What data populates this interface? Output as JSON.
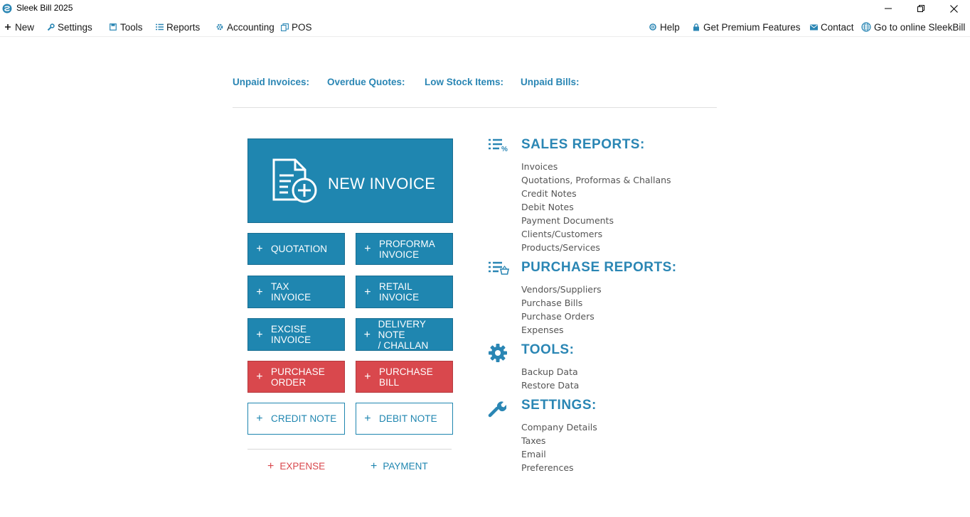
{
  "window": {
    "title": "Sleek Bill 2025"
  },
  "menu": {
    "left": [
      {
        "label": "New",
        "icon": "plus-icon"
      },
      {
        "label": "Settings",
        "icon": "wrench-icon"
      },
      {
        "label": "Tools",
        "icon": "floppy-icon"
      },
      {
        "label": "Reports",
        "icon": "list-icon"
      },
      {
        "label": "Accounting",
        "icon": "gear-icon"
      },
      {
        "label": "POS",
        "icon": "copy-icon"
      }
    ],
    "right": [
      {
        "label": "Help",
        "icon": "lifebuoy-icon"
      },
      {
        "label": "Get Premium Features",
        "icon": "lock-icon"
      },
      {
        "label": "Contact",
        "icon": "envelope-icon"
      },
      {
        "label": "Go to online SleekBill",
        "icon": "globe-icon"
      }
    ]
  },
  "status": {
    "unpaid_invoices": "Unpaid Invoices:",
    "overdue_quotes": "Overdue Quotes:",
    "low_stock": "Low Stock Items:",
    "unpaid_bills": "Unpaid Bills:"
  },
  "actions": {
    "new_invoice": "NEW INVOICE",
    "quotation": "QUOTATION",
    "proforma_1": "PROFORMA",
    "proforma_2": "INVOICE",
    "tax_1": "TAX",
    "tax_2": "INVOICE",
    "retail_1": "RETAIL",
    "retail_2": "INVOICE",
    "excise_1": "EXCISE",
    "excise_2": "INVOICE",
    "delivery_1": "DELIVERY NOTE",
    "delivery_2": "/ CHALLAN",
    "purchase_order_1": "PURCHASE",
    "purchase_order_2": "ORDER",
    "purchase_bill_1": "PURCHASE",
    "purchase_bill_2": "BILL",
    "credit_note": "CREDIT NOTE",
    "debit_note": "DEBIT NOTE",
    "expense": "EXPENSE",
    "payment": "PAYMENT",
    "plus": "+"
  },
  "reports": {
    "sales": {
      "title": "SALES REPORTS:",
      "items": [
        "Invoices",
        "Quotations, Proformas & Challans",
        "Credit Notes",
        "Debit Notes",
        "Payment Documents",
        "Clients/Customers",
        "Products/Services"
      ]
    },
    "purchase": {
      "title": "PURCHASE REPORTS:",
      "items": [
        "Vendors/Suppliers",
        "Purchase Bills",
        "Purchase Orders",
        "Expenses"
      ]
    },
    "tools": {
      "title": "TOOLS:",
      "items": [
        "Backup Data",
        "Restore Data"
      ]
    },
    "settings": {
      "title": "SETTINGS:",
      "items": [
        "Company Details",
        "Taxes",
        "Email",
        "Preferences"
      ]
    }
  },
  "colors": {
    "primary_blue": "#1f86b0",
    "heading_blue": "#2a86b4",
    "danger_red": "#d9484d",
    "expense_red": "#d9484d"
  }
}
